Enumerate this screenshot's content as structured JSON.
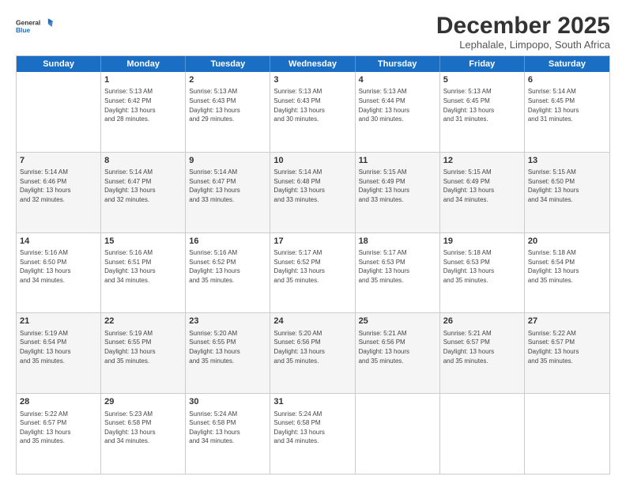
{
  "logo": {
    "line1": "General",
    "line2": "Blue"
  },
  "title": "December 2025",
  "subtitle": "Lephalale, Limpopo, South Africa",
  "days": [
    "Sunday",
    "Monday",
    "Tuesday",
    "Wednesday",
    "Thursday",
    "Friday",
    "Saturday"
  ],
  "weeks": [
    [
      {
        "day": "",
        "info": ""
      },
      {
        "day": "1",
        "info": "Sunrise: 5:13 AM\nSunset: 6:42 PM\nDaylight: 13 hours\nand 28 minutes."
      },
      {
        "day": "2",
        "info": "Sunrise: 5:13 AM\nSunset: 6:43 PM\nDaylight: 13 hours\nand 29 minutes."
      },
      {
        "day": "3",
        "info": "Sunrise: 5:13 AM\nSunset: 6:43 PM\nDaylight: 13 hours\nand 30 minutes."
      },
      {
        "day": "4",
        "info": "Sunrise: 5:13 AM\nSunset: 6:44 PM\nDaylight: 13 hours\nand 30 minutes."
      },
      {
        "day": "5",
        "info": "Sunrise: 5:13 AM\nSunset: 6:45 PM\nDaylight: 13 hours\nand 31 minutes."
      },
      {
        "day": "6",
        "info": "Sunrise: 5:14 AM\nSunset: 6:45 PM\nDaylight: 13 hours\nand 31 minutes."
      }
    ],
    [
      {
        "day": "7",
        "info": "Sunrise: 5:14 AM\nSunset: 6:46 PM\nDaylight: 13 hours\nand 32 minutes."
      },
      {
        "day": "8",
        "info": "Sunrise: 5:14 AM\nSunset: 6:47 PM\nDaylight: 13 hours\nand 32 minutes."
      },
      {
        "day": "9",
        "info": "Sunrise: 5:14 AM\nSunset: 6:47 PM\nDaylight: 13 hours\nand 33 minutes."
      },
      {
        "day": "10",
        "info": "Sunrise: 5:14 AM\nSunset: 6:48 PM\nDaylight: 13 hours\nand 33 minutes."
      },
      {
        "day": "11",
        "info": "Sunrise: 5:15 AM\nSunset: 6:49 PM\nDaylight: 13 hours\nand 33 minutes."
      },
      {
        "day": "12",
        "info": "Sunrise: 5:15 AM\nSunset: 6:49 PM\nDaylight: 13 hours\nand 34 minutes."
      },
      {
        "day": "13",
        "info": "Sunrise: 5:15 AM\nSunset: 6:50 PM\nDaylight: 13 hours\nand 34 minutes."
      }
    ],
    [
      {
        "day": "14",
        "info": "Sunrise: 5:16 AM\nSunset: 6:50 PM\nDaylight: 13 hours\nand 34 minutes."
      },
      {
        "day": "15",
        "info": "Sunrise: 5:16 AM\nSunset: 6:51 PM\nDaylight: 13 hours\nand 34 minutes."
      },
      {
        "day": "16",
        "info": "Sunrise: 5:16 AM\nSunset: 6:52 PM\nDaylight: 13 hours\nand 35 minutes."
      },
      {
        "day": "17",
        "info": "Sunrise: 5:17 AM\nSunset: 6:52 PM\nDaylight: 13 hours\nand 35 minutes."
      },
      {
        "day": "18",
        "info": "Sunrise: 5:17 AM\nSunset: 6:53 PM\nDaylight: 13 hours\nand 35 minutes."
      },
      {
        "day": "19",
        "info": "Sunrise: 5:18 AM\nSunset: 6:53 PM\nDaylight: 13 hours\nand 35 minutes."
      },
      {
        "day": "20",
        "info": "Sunrise: 5:18 AM\nSunset: 6:54 PM\nDaylight: 13 hours\nand 35 minutes."
      }
    ],
    [
      {
        "day": "21",
        "info": "Sunrise: 5:19 AM\nSunset: 6:54 PM\nDaylight: 13 hours\nand 35 minutes."
      },
      {
        "day": "22",
        "info": "Sunrise: 5:19 AM\nSunset: 6:55 PM\nDaylight: 13 hours\nand 35 minutes."
      },
      {
        "day": "23",
        "info": "Sunrise: 5:20 AM\nSunset: 6:55 PM\nDaylight: 13 hours\nand 35 minutes."
      },
      {
        "day": "24",
        "info": "Sunrise: 5:20 AM\nSunset: 6:56 PM\nDaylight: 13 hours\nand 35 minutes."
      },
      {
        "day": "25",
        "info": "Sunrise: 5:21 AM\nSunset: 6:56 PM\nDaylight: 13 hours\nand 35 minutes."
      },
      {
        "day": "26",
        "info": "Sunrise: 5:21 AM\nSunset: 6:57 PM\nDaylight: 13 hours\nand 35 minutes."
      },
      {
        "day": "27",
        "info": "Sunrise: 5:22 AM\nSunset: 6:57 PM\nDaylight: 13 hours\nand 35 minutes."
      }
    ],
    [
      {
        "day": "28",
        "info": "Sunrise: 5:22 AM\nSunset: 6:57 PM\nDaylight: 13 hours\nand 35 minutes."
      },
      {
        "day": "29",
        "info": "Sunrise: 5:23 AM\nSunset: 6:58 PM\nDaylight: 13 hours\nand 34 minutes."
      },
      {
        "day": "30",
        "info": "Sunrise: 5:24 AM\nSunset: 6:58 PM\nDaylight: 13 hours\nand 34 minutes."
      },
      {
        "day": "31",
        "info": "Sunrise: 5:24 AM\nSunset: 6:58 PM\nDaylight: 13 hours\nand 34 minutes."
      },
      {
        "day": "",
        "info": ""
      },
      {
        "day": "",
        "info": ""
      },
      {
        "day": "",
        "info": ""
      }
    ]
  ]
}
